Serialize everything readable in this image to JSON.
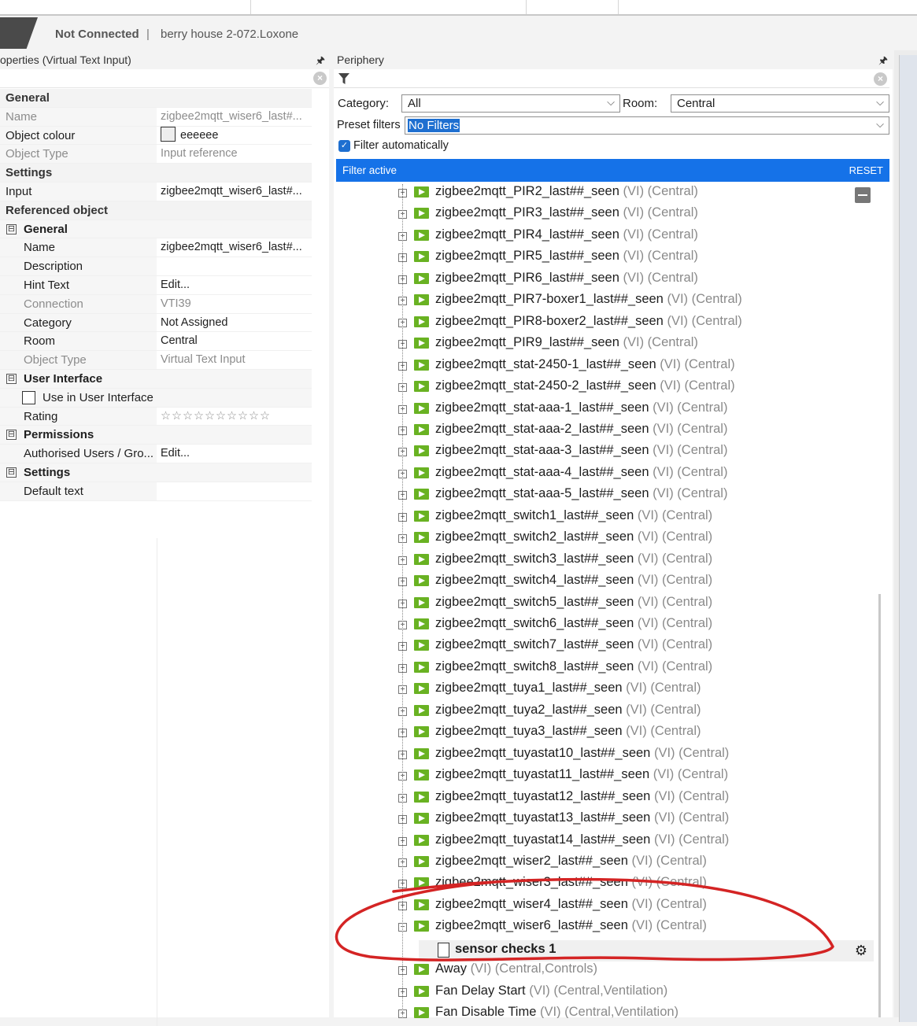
{
  "connection": {
    "status": "Not Connected",
    "separator": "|",
    "file": "berry house 2-072.Loxone"
  },
  "properties_panel": {
    "title": "operties (Virtual Text Input)",
    "pin_icon": "pin-icon",
    "rows": {
      "general": "General",
      "name_k": "Name",
      "name_v": "zigbee2mqtt_wiser6_last#...",
      "colour_k": "Object colour",
      "colour_v": "eeeeee",
      "type_k": "Object Type",
      "type_v": "Input reference",
      "settings": "Settings",
      "input_k": "Input",
      "input_v": "zigbee2mqtt_wiser6_last#...",
      "ref_obj": "Referenced object",
      "ref_general": "General",
      "ref_name_k": "Name",
      "ref_name_v": "zigbee2mqtt_wiser6_last#...",
      "desc_k": "Description",
      "hint_k": "Hint Text",
      "hint_v": "Edit...",
      "conn_k": "Connection",
      "conn_v": "VTI39",
      "cat_k": "Category",
      "cat_v": "Not Assigned",
      "room_k": "Room",
      "room_v": "Central",
      "otype_k": "Object Type",
      "otype_v": "Virtual Text Input",
      "ui": "User Interface",
      "use_ui": "Use in User Interface",
      "rating_k": "Rating",
      "rating_v": "☆☆☆☆☆☆☆☆☆☆",
      "perm": "Permissions",
      "auth_k": "Authorised Users / Gro...",
      "auth_v": "Edit...",
      "settings2": "Settings",
      "default_k": "Default text",
      "collapse_glyph": "⊟"
    }
  },
  "periphery_panel": {
    "title": "Periphery",
    "pin_icon": "pin-icon",
    "category_label": "Category:",
    "category_value": "All",
    "room_label": "Room:",
    "room_value": "Central",
    "preset_label": "Preset filters",
    "preset_value": "No Filters",
    "filter_auto": "Filter automatically",
    "banner_text": "Filter active",
    "reset": "RESET",
    "items": [
      {
        "name": "zigbee2mqtt_PIR2_last##_seen",
        "suffix": " (VI) (Central)"
      },
      {
        "name": "zigbee2mqtt_PIR3_last##_seen",
        "suffix": " (VI) (Central)"
      },
      {
        "name": "zigbee2mqtt_PIR4_last##_seen",
        "suffix": " (VI) (Central)"
      },
      {
        "name": "zigbee2mqtt_PIR5_last##_seen",
        "suffix": " (VI) (Central)"
      },
      {
        "name": "zigbee2mqtt_PIR6_last##_seen",
        "suffix": " (VI) (Central)"
      },
      {
        "name": "zigbee2mqtt_PIR7-boxer1_last##_seen",
        "suffix": " (VI) (Central)"
      },
      {
        "name": "zigbee2mqtt_PIR8-boxer2_last##_seen",
        "suffix": " (VI) (Central)"
      },
      {
        "name": "zigbee2mqtt_PIR9_last##_seen",
        "suffix": " (VI) (Central)"
      },
      {
        "name": "zigbee2mqtt_stat-2450-1_last##_seen",
        "suffix": " (VI) (Central)"
      },
      {
        "name": "zigbee2mqtt_stat-2450-2_last##_seen",
        "suffix": " (VI) (Central)"
      },
      {
        "name": "zigbee2mqtt_stat-aaa-1_last##_seen",
        "suffix": " (VI) (Central)"
      },
      {
        "name": "zigbee2mqtt_stat-aaa-2_last##_seen",
        "suffix": " (VI) (Central)"
      },
      {
        "name": "zigbee2mqtt_stat-aaa-3_last##_seen",
        "suffix": " (VI) (Central)"
      },
      {
        "name": "zigbee2mqtt_stat-aaa-4_last##_seen",
        "suffix": " (VI) (Central)"
      },
      {
        "name": "zigbee2mqtt_stat-aaa-5_last##_seen",
        "suffix": " (VI) (Central)"
      },
      {
        "name": "zigbee2mqtt_switch1_last##_seen",
        "suffix": " (VI) (Central)"
      },
      {
        "name": "zigbee2mqtt_switch2_last##_seen",
        "suffix": " (VI) (Central)"
      },
      {
        "name": "zigbee2mqtt_switch3_last##_seen",
        "suffix": " (VI) (Central)"
      },
      {
        "name": "zigbee2mqtt_switch4_last##_seen",
        "suffix": " (VI) (Central)"
      },
      {
        "name": "zigbee2mqtt_switch5_last##_seen",
        "suffix": " (VI) (Central)"
      },
      {
        "name": "zigbee2mqtt_switch6_last##_seen",
        "suffix": " (VI) (Central)"
      },
      {
        "name": "zigbee2mqtt_switch7_last##_seen",
        "suffix": " (VI) (Central)"
      },
      {
        "name": "zigbee2mqtt_switch8_last##_seen",
        "suffix": " (VI) (Central)"
      },
      {
        "name": "zigbee2mqtt_tuya1_last##_seen",
        "suffix": " (VI) (Central)"
      },
      {
        "name": "zigbee2mqtt_tuya2_last##_seen",
        "suffix": " (VI) (Central)"
      },
      {
        "name": "zigbee2mqtt_tuya3_last##_seen",
        "suffix": " (VI) (Central)"
      },
      {
        "name": "zigbee2mqtt_tuyastat10_last##_seen",
        "suffix": " (VI) (Central)"
      },
      {
        "name": "zigbee2mqtt_tuyastat11_last##_seen",
        "suffix": " (VI) (Central)"
      },
      {
        "name": "zigbee2mqtt_tuyastat12_last##_seen",
        "suffix": " (VI) (Central)"
      },
      {
        "name": "zigbee2mqtt_tuyastat13_last##_seen",
        "suffix": " (VI) (Central)"
      },
      {
        "name": "zigbee2mqtt_tuyastat14_last##_seen",
        "suffix": " (VI) (Central)"
      },
      {
        "name": "zigbee2mqtt_wiser2_last##_seen",
        "suffix": " (VI) (Central)"
      },
      {
        "name": "zigbee2mqtt_wiser3_last##_seen",
        "suffix": " (VI) (Central)"
      },
      {
        "name": "zigbee2mqtt_wiser4_last##_seen",
        "suffix": " (VI) (Central)"
      },
      {
        "name": "zigbee2mqtt_wiser6_last##_seen",
        "suffix": " (VI) (Central)"
      }
    ],
    "child": "sensor checks 1",
    "after_items": [
      {
        "name": "Away",
        "suffix": " (VI) (Central,Controls)"
      },
      {
        "name": "Fan Delay Start",
        "suffix": " (VI) (Central,Ventilation)"
      },
      {
        "name": "Fan Disable Time",
        "suffix": " (VI) (Central,Ventilation)"
      }
    ]
  },
  "colors": {
    "accent": "#1572e8",
    "vi_green": "#69b222",
    "annotation": "#d42424"
  }
}
